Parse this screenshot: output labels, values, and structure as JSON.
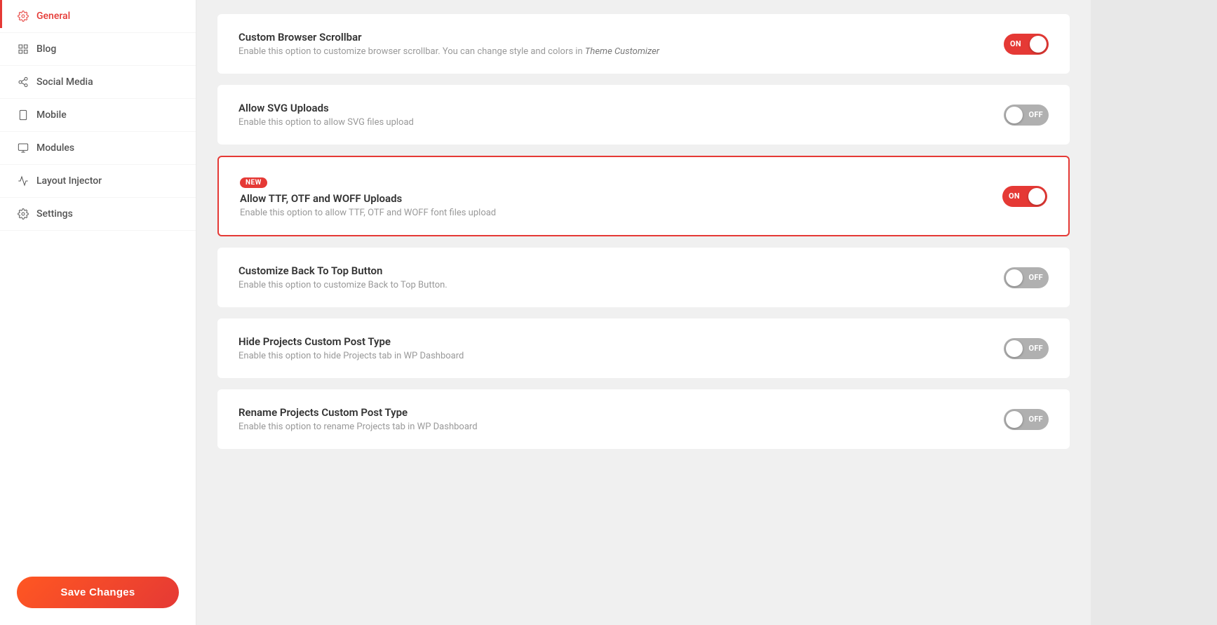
{
  "sidebar": {
    "items": [
      {
        "id": "general",
        "label": "General",
        "active": true,
        "icon": "gear"
      },
      {
        "id": "blog",
        "label": "Blog",
        "active": false,
        "icon": "grid"
      },
      {
        "id": "social-media",
        "label": "Social Media",
        "active": false,
        "icon": "share"
      },
      {
        "id": "mobile",
        "label": "Mobile",
        "active": false,
        "icon": "mobile"
      },
      {
        "id": "modules",
        "label": "Modules",
        "active": false,
        "icon": "modules"
      },
      {
        "id": "layout-injector",
        "label": "Layout Injector",
        "active": false,
        "icon": "layout"
      },
      {
        "id": "settings",
        "label": "Settings",
        "active": false,
        "icon": "settings"
      }
    ],
    "save_button_label": "Save Changes"
  },
  "settings": [
    {
      "id": "custom-browser-scrollbar",
      "title": "Custom Browser Scrollbar",
      "description": "Enable this option to customize browser scrollbar. You can change style and colors in ",
      "description_link": "Theme Customizer",
      "badge": null,
      "toggle_state": "on",
      "highlighted": false
    },
    {
      "id": "allow-svg-uploads",
      "title": "Allow SVG Uploads",
      "description": "Enable this option to allow SVG files upload",
      "description_link": null,
      "badge": null,
      "toggle_state": "off",
      "highlighted": false
    },
    {
      "id": "allow-font-uploads",
      "title": "Allow TTF, OTF and WOFF Uploads",
      "description": "Enable this option to allow TTF, OTF and WOFF font files upload",
      "description_link": null,
      "badge": "NEW",
      "toggle_state": "on",
      "highlighted": true
    },
    {
      "id": "customize-back-to-top",
      "title": "Customize Back To Top Button",
      "description": "Enable this option to customize Back to Top Button.",
      "description_link": null,
      "badge": null,
      "toggle_state": "off",
      "highlighted": false
    },
    {
      "id": "hide-projects-post-type",
      "title": "Hide Projects Custom Post Type",
      "description": "Enable this option to hide Projects tab in WP Dashboard",
      "description_link": null,
      "badge": null,
      "toggle_state": "off",
      "highlighted": false
    },
    {
      "id": "rename-projects-post-type",
      "title": "Rename Projects Custom Post Type",
      "description": "Enable this option to rename Projects tab in WP Dashboard",
      "description_link": null,
      "badge": null,
      "toggle_state": "off",
      "highlighted": false
    }
  ]
}
